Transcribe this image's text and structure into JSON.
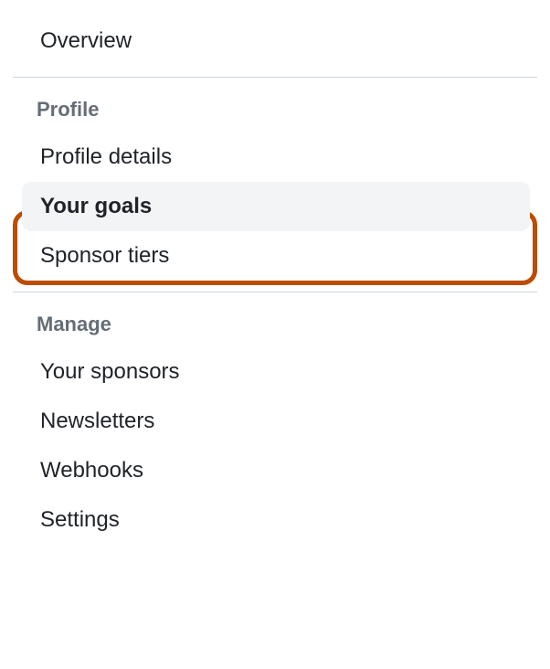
{
  "overview": {
    "label": "Overview"
  },
  "sections": [
    {
      "header": "Profile",
      "items": [
        {
          "label": "Profile details",
          "active": false
        },
        {
          "label": "Your goals",
          "active": true
        },
        {
          "label": "Sponsor tiers",
          "active": false
        }
      ]
    },
    {
      "header": "Manage",
      "items": [
        {
          "label": "Your sponsors",
          "active": false
        },
        {
          "label": "Newsletters",
          "active": false
        },
        {
          "label": "Webhooks",
          "active": false
        },
        {
          "label": "Settings",
          "active": false
        }
      ]
    }
  ]
}
